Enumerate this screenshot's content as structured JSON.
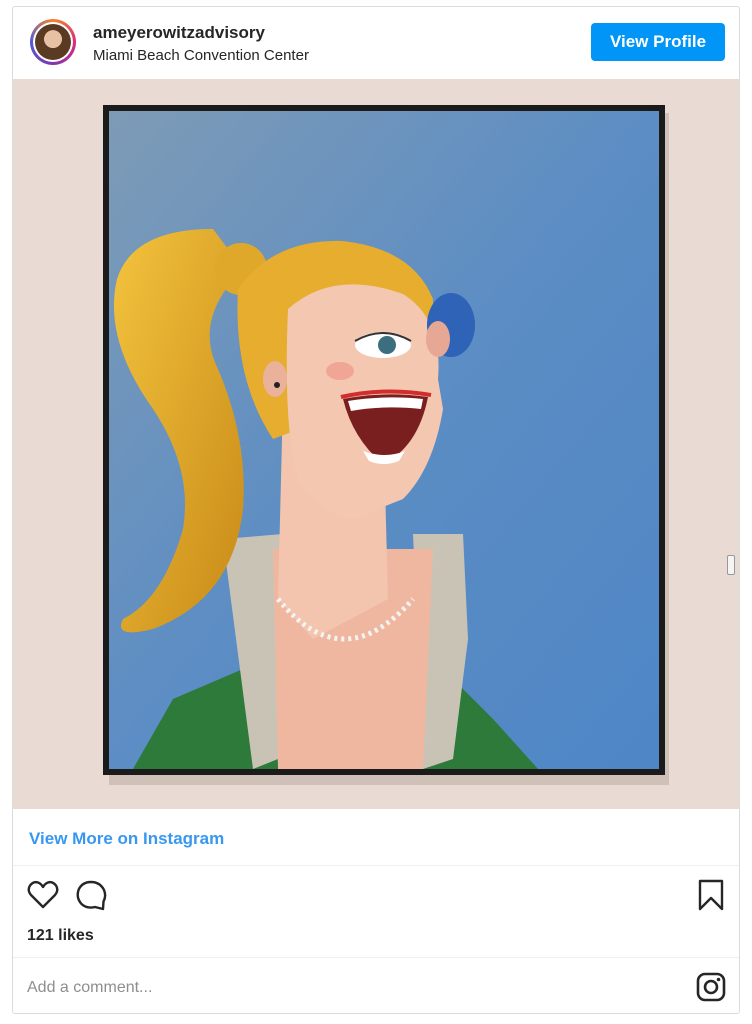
{
  "post": {
    "username": "ameyerowitzadvisory",
    "location": "Miami Beach Convention Center",
    "view_profile_label": "View Profile",
    "view_more_label": "View More on Instagram",
    "likes": "121 likes",
    "comment_placeholder": "Add a comment..."
  },
  "icons": {
    "like": "heart-icon",
    "comment": "speech-bubble-icon",
    "save": "bookmark-icon",
    "brand": "instagram-logo-icon"
  },
  "colors": {
    "button": "#0095f6",
    "link": "#3897f0",
    "border": "#dbdbdb"
  }
}
